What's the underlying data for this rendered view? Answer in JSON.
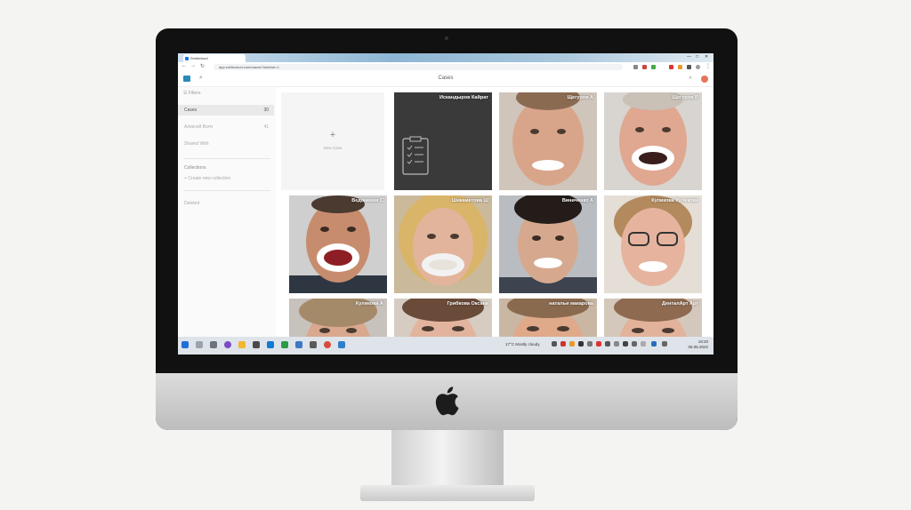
{
  "browser": {
    "tab_title": "Smilecloud",
    "tab2_title": "",
    "url": "app.smilecloud.com/cases/?sidebar=1"
  },
  "app": {
    "title": "Cases"
  },
  "sidebar": {
    "filters_label": "Filters",
    "items": [
      {
        "label": "Cases",
        "count": "30"
      },
      {
        "label": "Алексей Волч",
        "count": "41"
      },
      {
        "label": "Shared With",
        "count": ""
      }
    ],
    "collections_heading": "Collections",
    "create_collection": "Create new collection",
    "deleted_label": "Deleted"
  },
  "grid": {
    "new_case_label": "New Case",
    "cases": [
      {
        "name": "Искандыров Кайрат",
        "kind": "document"
      },
      {
        "name": "Щегуров А",
        "kind": "face"
      },
      {
        "name": "Щегуров В",
        "kind": "face"
      },
      {
        "name": "Ведомекия С",
        "kind": "face"
      },
      {
        "name": "Шикаметова Ш",
        "kind": "face"
      },
      {
        "name": "Виниченко А",
        "kind": "face"
      },
      {
        "name": "Куликова Куликова",
        "kind": "face"
      },
      {
        "name": "Куликова А",
        "kind": "face"
      },
      {
        "name": "Грибкова Оксана",
        "kind": "face"
      },
      {
        "name": "натальи макарова",
        "kind": "face"
      },
      {
        "name": "ДенталАрт Арт",
        "kind": "face"
      }
    ]
  },
  "taskbar": {
    "weather": "17°C  Mostly cloudy",
    "time": "19:20",
    "date": "06.05.2022"
  },
  "colors": {
    "accent": "#2a8ab8",
    "avatar": "#e8735a",
    "document_card": "#3a3a3a"
  }
}
